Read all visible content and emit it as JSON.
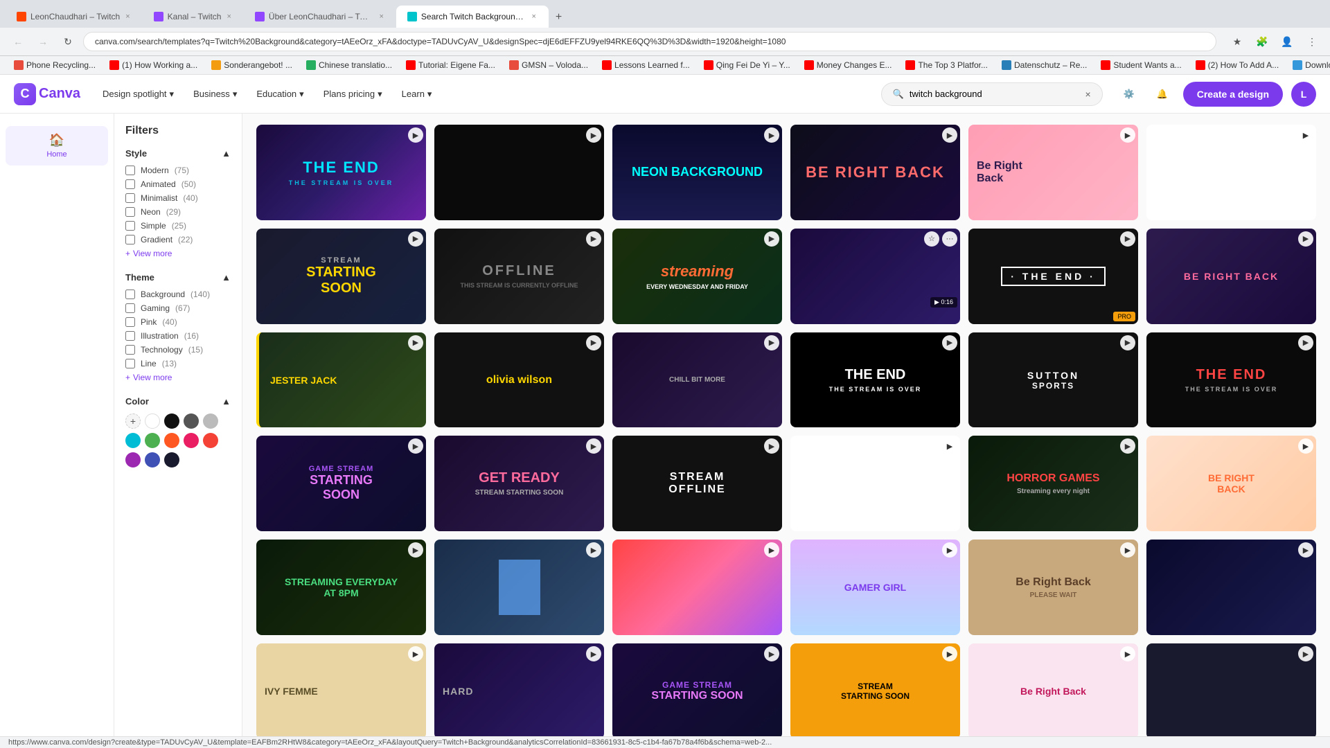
{
  "browser": {
    "tabs": [
      {
        "id": "tab1",
        "favicon_color": "#ff4500",
        "title": "LeonChaudhari – Twitch",
        "active": false
      },
      {
        "id": "tab2",
        "favicon_color": "#9146ff",
        "title": "Kanal – Twitch",
        "active": false
      },
      {
        "id": "tab3",
        "favicon_color": "#9146ff",
        "title": "Über LeonChaudhari – Twitch",
        "active": false
      },
      {
        "id": "tab4",
        "favicon_color": "#00c4cc",
        "title": "Search Twitch Background – C...",
        "active": true
      }
    ],
    "address": "canva.com/search/templates?q=Twitch%20Background&category=tAEeOrz_xFA&doctype=TADUvCyAV_U&designSpec=djE6dEFFZU9yel94RKE6QQ%3D%3D&width=1920&height=1080",
    "bookmarks": [
      {
        "label": "Phone Recycling..."
      },
      {
        "label": "(1) How Working a..."
      },
      {
        "label": "Sonderangebot! ..."
      },
      {
        "label": "Chinese translatio..."
      },
      {
        "label": "Tutorial: Eigene Fa..."
      },
      {
        "label": "GMSN – Voloda..."
      },
      {
        "label": "Lessons Learned f..."
      },
      {
        "label": "Qing Fei De Yi – Y..."
      },
      {
        "label": "Money Changes E..."
      },
      {
        "label": "The Top 3 Platfor..."
      },
      {
        "label": "Datenschutz – Re..."
      },
      {
        "label": "Student Wants a..."
      },
      {
        "label": "(2) How To Add A..."
      },
      {
        "label": "Download – Cook..."
      }
    ]
  },
  "canva": {
    "logo": "Canva",
    "nav": [
      {
        "label": "Design spotlight",
        "has_dropdown": true
      },
      {
        "label": "Business",
        "has_dropdown": true
      },
      {
        "label": "Education",
        "has_dropdown": true
      },
      {
        "label": "Plans pricing",
        "has_dropdown": true
      },
      {
        "label": "Learn",
        "has_dropdown": true
      }
    ],
    "search": {
      "placeholder": "Search",
      "value": "twitch background",
      "clear_btn": "×"
    },
    "create_btn": "Create a design",
    "user_initials": "L"
  },
  "sidebar": {
    "items": [
      {
        "id": "home",
        "icon": "🏠",
        "label": "Home"
      }
    ]
  },
  "filters": {
    "title": "Filters",
    "sections": [
      {
        "id": "style",
        "label": "Style",
        "collapsed": false,
        "options": [
          {
            "label": "Modern",
            "count": 75,
            "checked": false
          },
          {
            "label": "Animated",
            "count": 50,
            "checked": false
          },
          {
            "label": "Minimalist",
            "count": 40,
            "checked": false
          },
          {
            "label": "Neon",
            "count": 29,
            "checked": false
          },
          {
            "label": "Simple",
            "count": 25,
            "checked": false
          },
          {
            "label": "Gradient",
            "count": 22,
            "checked": false
          }
        ],
        "show_more": true
      },
      {
        "id": "theme",
        "label": "Theme",
        "collapsed": false,
        "options": [
          {
            "label": "Background",
            "count": 140,
            "checked": false
          },
          {
            "label": "Gaming",
            "count": 67,
            "checked": false
          },
          {
            "label": "Pink",
            "count": 40,
            "checked": false
          },
          {
            "label": "Illustration",
            "count": 16,
            "checked": false
          },
          {
            "label": "Technology",
            "count": 15,
            "checked": false
          },
          {
            "label": "Line",
            "count": 13,
            "checked": false
          }
        ],
        "show_more": true
      },
      {
        "id": "color",
        "label": "Color",
        "collapsed": false,
        "swatches": [
          {
            "color": "#ffffff",
            "label": "white"
          },
          {
            "color": "#111111",
            "label": "black"
          },
          {
            "color": "#555555",
            "label": "gray"
          },
          {
            "color": "#bbbbbb",
            "label": "light-gray"
          },
          {
            "color": "#00bcd4",
            "label": "cyan"
          },
          {
            "color": "#4caf50",
            "label": "green"
          },
          {
            "color": "#ff5722",
            "label": "orange-red"
          },
          {
            "color": "#e91e63",
            "label": "pink"
          },
          {
            "color": "#f44336",
            "label": "red"
          },
          {
            "color": "#9c27b0",
            "label": "purple"
          },
          {
            "color": "#3f51b5",
            "label": "indigo"
          },
          {
            "color": "#1a1a2e",
            "label": "dark-navy"
          }
        ]
      }
    ]
  },
  "templates": [
    {
      "id": 1,
      "theme": "the-end",
      "title": "THE END",
      "subtitle": "THE STREAM IS OVER",
      "row": 1,
      "has_play": true,
      "badge": ""
    },
    {
      "id": 2,
      "theme": "dark",
      "title": "",
      "subtitle": "",
      "row": 1,
      "has_play": true,
      "badge": ""
    },
    {
      "id": 3,
      "theme": "neon",
      "title": "NEON BACKGROUND",
      "subtitle": "",
      "row": 1,
      "has_play": true,
      "badge": ""
    },
    {
      "id": 4,
      "theme": "be-right-back",
      "title": "BE RIGHT BACK",
      "subtitle": "",
      "row": 1,
      "has_play": true,
      "badge": ""
    },
    {
      "id": 5,
      "theme": "be-right-back-pink",
      "title": "Be Right Back",
      "subtitle": "",
      "row": 1,
      "has_play": true,
      "badge": ""
    },
    {
      "id": 6,
      "theme": "black-white",
      "title": "",
      "subtitle": "",
      "row": 1,
      "has_play": true,
      "badge": ""
    },
    {
      "id": 7,
      "theme": "stream-starting",
      "title": "STREAM STARTING SOON",
      "subtitle": "",
      "row": 2,
      "has_play": true,
      "badge": ""
    },
    {
      "id": 8,
      "theme": "offline",
      "title": "OFFLINE",
      "subtitle": "THIS STREAM IS CURRENTLY OFFLINE",
      "row": 2,
      "has_play": true,
      "badge": ""
    },
    {
      "id": 9,
      "theme": "streaming",
      "title": "streaming",
      "subtitle": "EVERY WEDNESDAY AND FRIDAY",
      "row": 2,
      "has_play": true,
      "badge": ""
    },
    {
      "id": 10,
      "theme": "purple-grid",
      "title": "",
      "subtitle": "",
      "row": 2,
      "has_play": true,
      "badge": "0:16",
      "is_pro": false
    },
    {
      "id": 11,
      "theme": "the-end-dark",
      "title": "THE END",
      "subtitle": "",
      "row": 2,
      "has_play": true,
      "badge": "",
      "is_pro": true
    },
    {
      "id": 12,
      "theme": "be-right-back-pink",
      "title": "BE RIGHT BACK",
      "subtitle": "",
      "row": 2,
      "has_play": true,
      "badge": ""
    },
    {
      "id": 13,
      "theme": "jester",
      "title": "JESTER JACK",
      "subtitle": "",
      "row": 3,
      "has_play": true,
      "badge": ""
    },
    {
      "id": 14,
      "theme": "olivia",
      "title": "olivia wilson",
      "subtitle": "",
      "row": 3,
      "has_play": true,
      "badge": ""
    },
    {
      "id": 15,
      "theme": "chill-bit",
      "title": "CHILL BIT MORE",
      "subtitle": "",
      "row": 3,
      "has_play": true,
      "badge": ""
    },
    {
      "id": 16,
      "theme": "the-end-triangle",
      "title": "THE END",
      "subtitle": "THE STREAM IS OVER",
      "row": 3,
      "has_play": true,
      "badge": ""
    },
    {
      "id": 17,
      "theme": "sports",
      "title": "SUTTON SPORTS",
      "subtitle": "",
      "row": 3,
      "has_play": true,
      "badge": ""
    },
    {
      "id": 18,
      "theme": "the-end-red",
      "title": "THE END",
      "subtitle": "THE STREAM IS OVER",
      "row": 3,
      "has_play": true,
      "badge": ""
    },
    {
      "id": 19,
      "theme": "game-stream",
      "title": "GAME STREAM STARTING SOON",
      "subtitle": "",
      "row": 4,
      "has_play": true,
      "badge": ""
    },
    {
      "id": 20,
      "theme": "get-ready",
      "title": "GET READY",
      "subtitle": "STREAM STARTING SOON",
      "row": 4,
      "has_play": true,
      "badge": ""
    },
    {
      "id": 21,
      "theme": "stream-offline",
      "title": "STREAM OFFLINE",
      "subtitle": "",
      "row": 4,
      "has_play": true,
      "badge": ""
    },
    {
      "id": 22,
      "theme": "kawaii",
      "title": "",
      "subtitle": "",
      "row": 4,
      "has_play": true,
      "badge": ""
    },
    {
      "id": 23,
      "theme": "horror",
      "title": "HORROR GAMES",
      "subtitle": "Streaming every night",
      "row": 4,
      "has_play": true,
      "badge": ""
    },
    {
      "id": 24,
      "theme": "be-right-back-peach",
      "title": "BE RIGHT BACK",
      "subtitle": "",
      "row": 4,
      "has_play": true,
      "badge": ""
    },
    {
      "id": 25,
      "theme": "streaming-everyday",
      "title": "STREAMING EVERYDAY AT 8PM",
      "subtitle": "",
      "row": 5,
      "has_play": true,
      "badge": ""
    },
    {
      "id": 26,
      "theme": "blue-rect",
      "title": "",
      "subtitle": "",
      "row": 5,
      "has_play": true,
      "badge": ""
    },
    {
      "id": 27,
      "theme": "gradient-red",
      "title": "",
      "subtitle": "",
      "row": 5,
      "has_play": true,
      "badge": ""
    },
    {
      "id": 28,
      "theme": "gamer-girl",
      "title": "GAMER GIRL",
      "subtitle": "",
      "row": 5,
      "has_play": true,
      "badge": ""
    },
    {
      "id": 29,
      "theme": "be-right-back-tan",
      "title": "Be Right Back",
      "subtitle": "PLEASE WAIT",
      "row": 5,
      "has_play": true,
      "badge": ""
    },
    {
      "id": 30,
      "theme": "space",
      "title": "",
      "subtitle": "",
      "row": 5,
      "has_play": true,
      "badge": ""
    },
    {
      "id": 31,
      "theme": "ivy-femme",
      "title": "IVY FEMME",
      "subtitle": "",
      "row": 6,
      "has_play": true,
      "badge": ""
    },
    {
      "id": 32,
      "theme": "hard",
      "title": "HARD",
      "subtitle": "",
      "row": 6,
      "has_play": true,
      "badge": ""
    },
    {
      "id": 33,
      "theme": "game-stream-2",
      "title": "GAME STREAM STARTING SOON",
      "subtitle": "",
      "row": 6,
      "has_play": true,
      "badge": ""
    },
    {
      "id": 34,
      "theme": "stream-starting-orange",
      "title": "STREAM STARTING SOON",
      "subtitle": "",
      "row": 6,
      "has_play": true,
      "badge": ""
    },
    {
      "id": 35,
      "theme": "be-right-back-pink2",
      "title": "Be Right Back",
      "subtitle": "",
      "row": 6,
      "has_play": true,
      "badge": ""
    },
    {
      "id": 36,
      "theme": "unknown",
      "title": "",
      "subtitle": "",
      "row": 6,
      "has_play": true,
      "badge": ""
    }
  ],
  "theme_colors": {
    "the-end": {
      "bg": "linear-gradient(135deg, #1a0a3c 0%, #2d1b69 50%, #6b21a8 100%)",
      "color": "#00e5ff"
    },
    "dark": {
      "bg": "#0a0a0a",
      "color": "#333"
    },
    "neon": {
      "bg": "linear-gradient(180deg, #0a0a2e 0%, #1a1a4e 100%)",
      "color": "#00ffff"
    },
    "be-right-back": {
      "bg": "linear-gradient(135deg, #0d0d1a, #1a0a3c)",
      "color": "#ff6b9d"
    },
    "be-right-back-pink": {
      "bg": "linear-gradient(135deg, #ff6b9d, #ff9a9e)",
      "color": "#fff"
    },
    "black-white": {
      "bg": "#000",
      "color": "#fff"
    },
    "stream-starting": {
      "bg": "linear-gradient(135deg, #1a1a2e, #16213e)",
      "color": "#ffd700"
    },
    "offline": {
      "bg": "linear-gradient(135deg, #111, #222)",
      "color": "#a0a0a0"
    },
    "streaming": {
      "bg": "linear-gradient(135deg, #ff6b35, #ff9f1c)",
      "color": "#fff"
    },
    "purple-grid": {
      "bg": "linear-gradient(135deg, #1a0a3c, #2d1b69)",
      "color": "#a855f7"
    },
    "the-end-dark": {
      "bg": "#111",
      "color": "#fff"
    },
    "jester": {
      "bg": "linear-gradient(135deg, #1a2e1a, #2e4a1a)",
      "color": "#ffd700"
    },
    "olivia": {
      "bg": "#111",
      "color": "#ffd700"
    },
    "chill-bit": {
      "bg": "linear-gradient(135deg, #1a0a2e, #2d1b4e)",
      "color": "#ff6b9d"
    },
    "the-end-triangle": {
      "bg": "#000",
      "color": "#fff"
    },
    "sports": {
      "bg": "#111",
      "color": "#fff"
    },
    "the-end-red": {
      "bg": "#0a0a0a",
      "color": "#ff4444"
    },
    "game-stream": {
      "bg": "linear-gradient(135deg, #1a0a3c, #0d0d2e)",
      "color": "#a855f7"
    },
    "get-ready": {
      "bg": "linear-gradient(135deg, #1a0a2e, #2d1b4e)",
      "color": "#ff6b9d"
    },
    "stream-offline": {
      "bg": "#111",
      "color": "#fff"
    },
    "kawaii": {
      "bg": "#fff",
      "color": "#ff6b9d"
    },
    "horror": {
      "bg": "linear-gradient(135deg, #0a1a0a, #1a2e1a)",
      "color": "#ff4444"
    },
    "be-right-back-peach": {
      "bg": "linear-gradient(135deg, #ffe0cc, #ffcba4)",
      "color": "#ff6b35"
    },
    "streaming-everyday": {
      "bg": "linear-gradient(135deg, #0a1a0a, #1a2e0a)",
      "color": "#4ade80"
    },
    "blue-rect": {
      "bg": "linear-gradient(135deg, #1a2e4a, #2d4a6e)",
      "color": "#60a5fa"
    },
    "gradient-red": {
      "bg": "linear-gradient(135deg, #ff4444, #ff6b9d, #a855f7)",
      "color": "#fff"
    },
    "gamer-girl": {
      "bg": "linear-gradient(180deg, #e0b3ff, #b3d9ff)",
      "color": "#7c3aed"
    },
    "be-right-back-tan": {
      "bg": "#c8a97d",
      "color": "#5a3e28"
    },
    "space": {
      "bg": "linear-gradient(135deg, #0a0a2e, #1a1a4e)",
      "color": "#60a5fa"
    },
    "ivy-femme": {
      "bg": "#e8d5a3",
      "color": "#5a4e28"
    },
    "hard": {
      "bg": "linear-gradient(135deg, #1a0a3c, #2d1b69)",
      "color": "#ffd700"
    },
    "game-stream-2": {
      "bg": "linear-gradient(135deg, #1a0a3c, #0d0d2e)",
      "color": "#a855f7"
    },
    "stream-starting-orange": {
      "bg": "#f59e0b",
      "color": "#000"
    },
    "be-right-back-pink2": {
      "bg": "#f9e4f0",
      "color": "#c2185b"
    },
    "unknown": {
      "bg": "#1a1a2e",
      "color": "#fff"
    }
  }
}
